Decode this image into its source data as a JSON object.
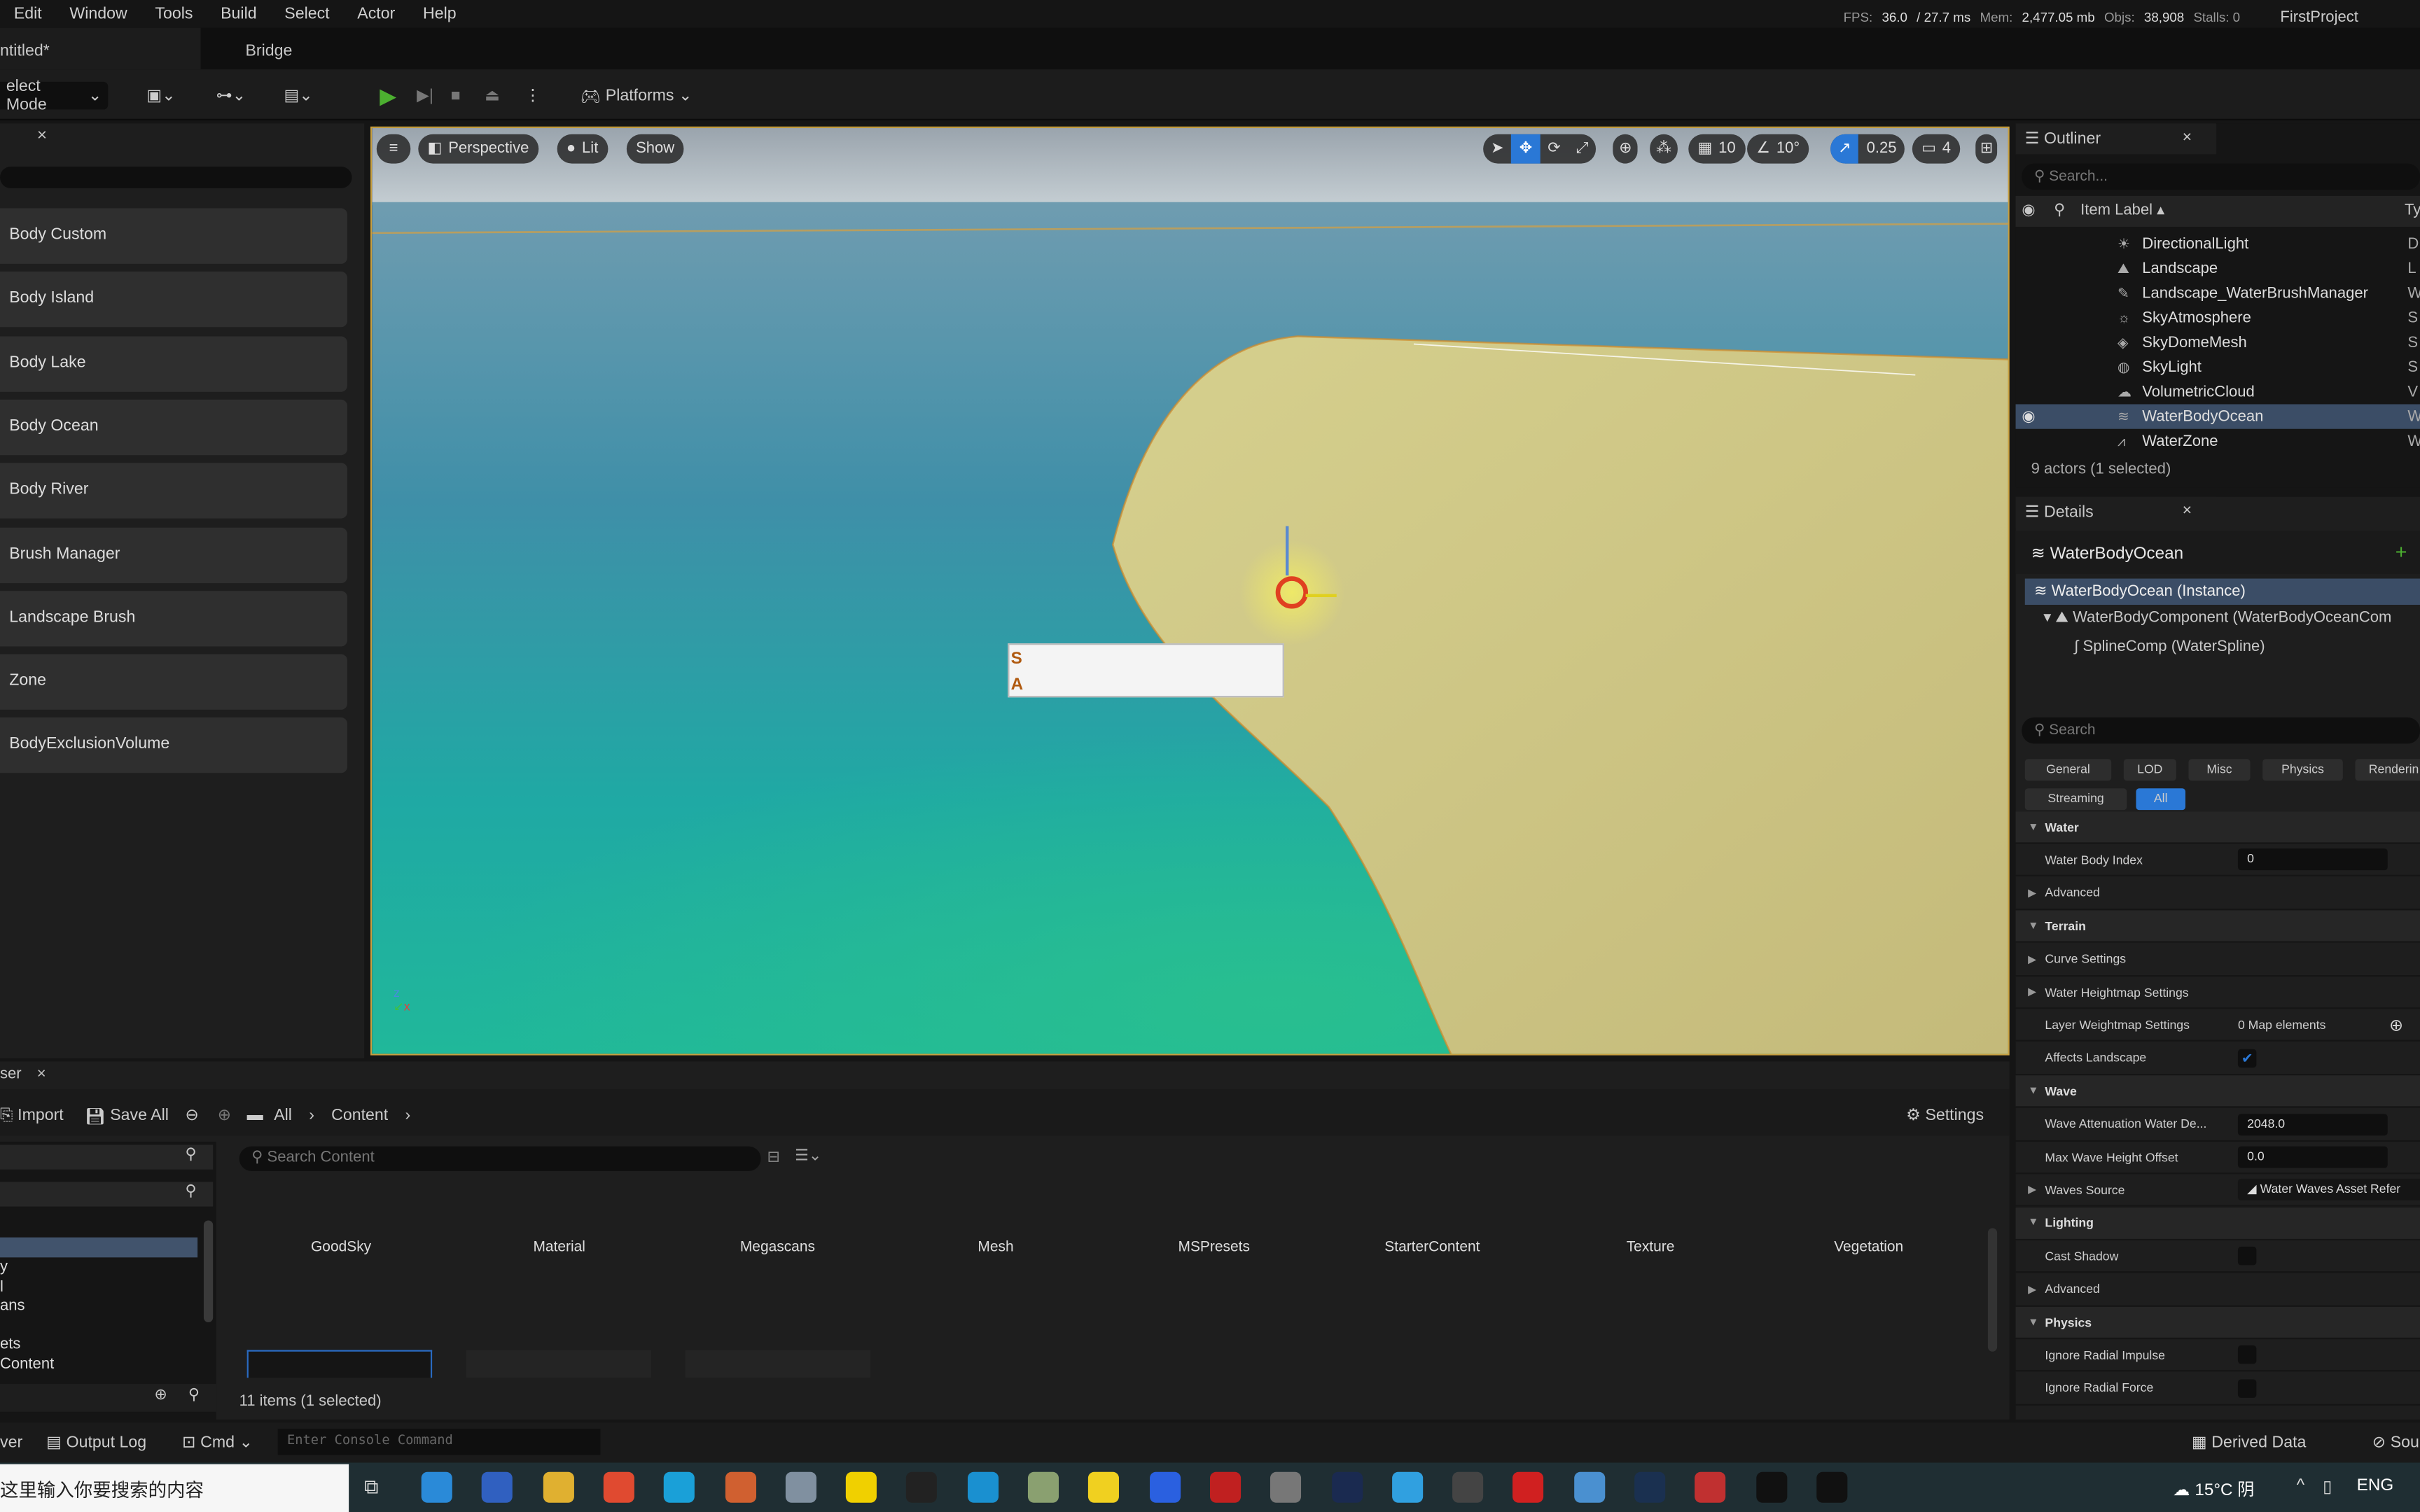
{
  "menu": [
    "Edit",
    "Window",
    "Tools",
    "Build",
    "Select",
    "Actor",
    "Help"
  ],
  "stats": {
    "fps_label": "FPS:",
    "fps": "36.0",
    "ms": "/ 27.7 ms",
    "mem_label": "Mem:",
    "mem": "2,477.05 mb",
    "objs_label": "Objs:",
    "objs": "38,908",
    "stalls": "Stalls: 0",
    "project": "FirstProject"
  },
  "tabs": {
    "level": "ntitled*",
    "bridge": "Bridge"
  },
  "toolbar": {
    "mode": "elect Mode",
    "platforms": "Platforms"
  },
  "place_panel": {
    "items": [
      "Body Custom",
      "Body Island",
      "Body Lake",
      "Body Ocean",
      "Body River",
      "Brush Manager",
      "Landscape Brush",
      "Zone",
      "BodyExclusionVolume"
    ]
  },
  "viewport": {
    "perspective": "Perspective",
    "lit": "Lit",
    "show": "Show",
    "grid": "10",
    "angle": "10°",
    "scale": "0.25",
    "camera_speed": "4",
    "overlay_lines": [
      "S",
      "A"
    ],
    "colors": {
      "selection_border": "#c8a040",
      "accent": "#2a78d6"
    }
  },
  "outliner": {
    "title": "Outliner",
    "search_placeholder": "Search...",
    "col_label": "Item Label ▴",
    "col_type": "Ty",
    "rows": [
      {
        "label": "DirectionalLight",
        "type": "D"
      },
      {
        "label": "Landscape",
        "type": "L"
      },
      {
        "label": "Landscape_WaterBrushManager",
        "type": "W"
      },
      {
        "label": "SkyAtmosphere",
        "type": "S"
      },
      {
        "label": "SkyDomeMesh",
        "type": "S"
      },
      {
        "label": "SkyLight",
        "type": "S"
      },
      {
        "label": "VolumetricCloud",
        "type": "V"
      },
      {
        "label": "WaterBodyOcean",
        "type": "W",
        "selected": true
      },
      {
        "label": "WaterZone",
        "type": "W"
      }
    ],
    "footer": "9 actors (1 selected)"
  },
  "details": {
    "title": "Details",
    "actor": "WaterBodyOcean",
    "add": "+",
    "components": [
      "WaterBodyOcean (Instance)",
      "WaterBodyComponent (WaterBodyOceanCom",
      "SplineComp (WaterSpline)"
    ],
    "search_placeholder": "Search",
    "categories": [
      "General",
      "LOD",
      "Misc",
      "Physics",
      "Renderin",
      "Streaming",
      "All"
    ],
    "rows": [
      {
        "t": "sec",
        "label": "Water"
      },
      {
        "t": "field",
        "label": "Water Body Index",
        "value": "0"
      },
      {
        "t": "sub",
        "label": "Advanced"
      },
      {
        "t": "sec",
        "label": "Terrain"
      },
      {
        "t": "sub",
        "label": "Curve Settings"
      },
      {
        "t": "sub",
        "label": "Water Heightmap Settings"
      },
      {
        "t": "text",
        "label": "Layer Weightmap Settings",
        "value": "0 Map elements"
      },
      {
        "t": "check",
        "label": "Affects Landscape",
        "checked": true
      },
      {
        "t": "sec",
        "label": "Wave"
      },
      {
        "t": "field",
        "label": "Wave Attenuation Water De...",
        "value": "2048.0"
      },
      {
        "t": "field",
        "label": "Max Wave Height Offset",
        "value": "0.0"
      },
      {
        "t": "asset",
        "label": "Waves Source",
        "value": "Water Waves Asset Refer"
      },
      {
        "t": "sec",
        "label": "Lighting"
      },
      {
        "t": "check",
        "label": "Cast Shadow",
        "checked": false
      },
      {
        "t": "sub",
        "label": "Advanced"
      },
      {
        "t": "sec",
        "label": "Physics"
      },
      {
        "t": "check",
        "label": "Ignore Radial Impulse",
        "checked": false
      },
      {
        "t": "check",
        "label": "Ignore Radial Force",
        "checked": false
      }
    ]
  },
  "content_browser": {
    "tab": "ser",
    "import": "Import",
    "save_all": "Save All",
    "crumbs": [
      "All",
      "Content"
    ],
    "settings": "Settings",
    "search_placeholder": "Search Content",
    "tree": [
      "y",
      "l",
      "ans",
      "",
      "ets",
      "Content"
    ],
    "folders": [
      "GoodSky",
      "Material",
      "Megascans",
      "Mesh",
      "MSPresets",
      "StarterContent",
      "Texture",
      "Vegetation"
    ],
    "count": "11 items (1 selected)"
  },
  "statusbar": {
    "drawer": "ver",
    "output_log": "Output Log",
    "cmd": "Cmd",
    "console_placeholder": "Enter Console Command",
    "derived": "Derived Data",
    "source": "Sou"
  },
  "taskbar": {
    "search": "这里输入你要搜索的内容",
    "weather": "15°C 阴",
    "lang": "ENG"
  }
}
